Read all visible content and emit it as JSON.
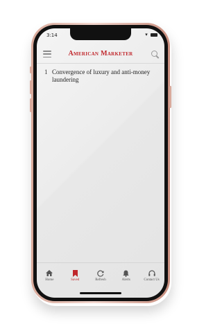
{
  "status_bar": {
    "time": "3:14"
  },
  "header": {
    "brand": "American Marketer"
  },
  "articles": [
    {
      "number": "1",
      "title": "Convergence of luxury and anti-money laundering"
    }
  ],
  "tabs": [
    {
      "label": "Home",
      "icon": "home-icon",
      "active": false
    },
    {
      "label": "Saved",
      "icon": "bookmark-icon",
      "active": true
    },
    {
      "label": "Refresh",
      "icon": "refresh-icon",
      "active": false
    },
    {
      "label": "Alerts",
      "icon": "bell-icon",
      "active": false
    },
    {
      "label": "Contact Us",
      "icon": "headphones-icon",
      "active": false
    }
  ],
  "colors": {
    "brand": "#c0262b",
    "tab_inactive": "#555555"
  }
}
